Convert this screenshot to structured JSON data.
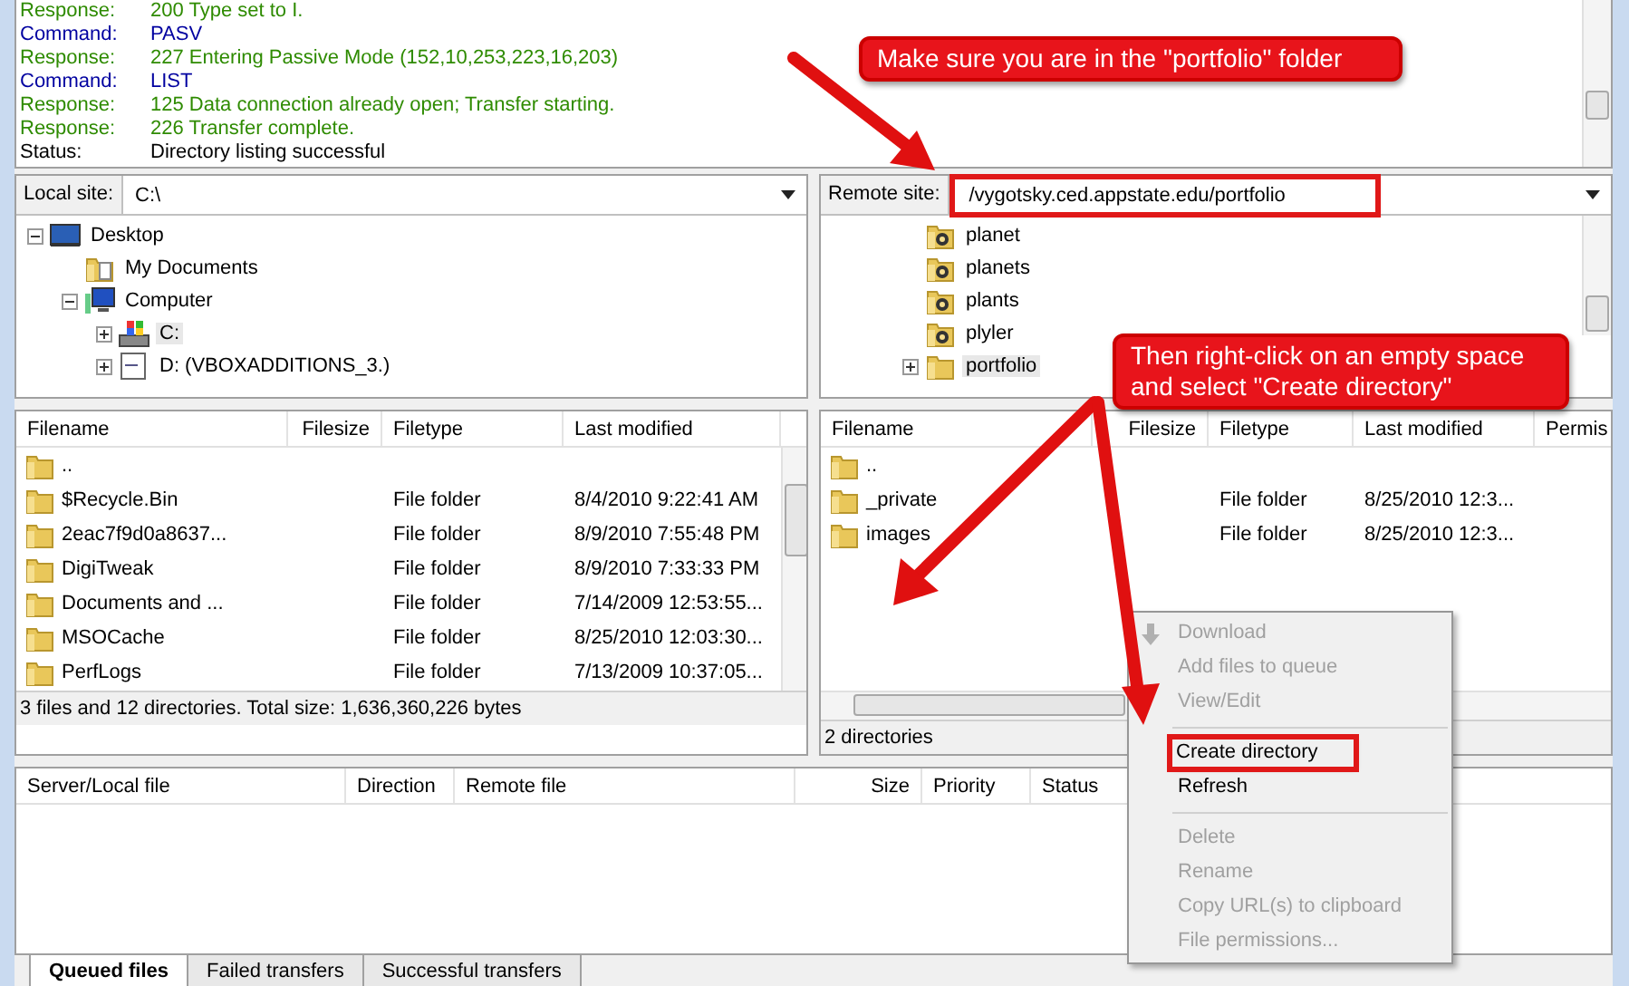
{
  "message_log": [
    {
      "kind": "response",
      "label": "Response:",
      "text": "200 Type set to I."
    },
    {
      "kind": "command",
      "label": "Command:",
      "text": "PASV"
    },
    {
      "kind": "response",
      "label": "Response:",
      "text": "227 Entering Passive Mode (152,10,253,223,16,203)"
    },
    {
      "kind": "command",
      "label": "Command:",
      "text": "LIST"
    },
    {
      "kind": "response",
      "label": "Response:",
      "text": "125 Data connection already open; Transfer starting."
    },
    {
      "kind": "response",
      "label": "Response:",
      "text": "226 Transfer complete."
    },
    {
      "kind": "status",
      "label": "Status:",
      "text": "Directory listing successful"
    }
  ],
  "local_site": {
    "label": "Local site:",
    "path": "C:\\",
    "highlighted": false,
    "tree": [
      {
        "kind": "desktop",
        "name": "Desktop",
        "expanded": true,
        "selected": false,
        "children": [
          {
            "kind": "documents",
            "name": "My Documents",
            "selected": false
          },
          {
            "kind": "computer",
            "name": "Computer",
            "expanded": true,
            "selected": false,
            "children": [
              {
                "kind": "system-drive",
                "name": "C:",
                "expanded": false,
                "selected": true
              },
              {
                "kind": "cd-drive",
                "name": "D: (VBOXADDITIONS_3.)",
                "expanded": false,
                "selected": false
              }
            ]
          }
        ]
      }
    ],
    "files": {
      "columns": [
        "Filename",
        "Filesize",
        "Filetype",
        "Last modified"
      ],
      "rows": [
        {
          "name": "..",
          "type": "",
          "modified": ""
        },
        {
          "name": "$Recycle.Bin",
          "type": "File folder",
          "modified": "8/4/2010 9:22:41 AM"
        },
        {
          "name": "2eac7f9d0a8637...",
          "type": "File folder",
          "modified": "8/9/2010 7:55:48 PM"
        },
        {
          "name": "DigiTweak",
          "type": "File folder",
          "modified": "8/9/2010 7:33:33 PM"
        },
        {
          "name": "Documents and ...",
          "type": "File folder",
          "modified": "7/14/2009 12:53:55..."
        },
        {
          "name": "MSOCache",
          "type": "File folder",
          "modified": "8/25/2010 12:03:30..."
        },
        {
          "name": "PerfLogs",
          "type": "File folder",
          "modified": "7/13/2009 10:37:05..."
        }
      ]
    },
    "status": "3 files and 12 directories. Total size: 1,636,360,226 bytes"
  },
  "remote_site": {
    "label": "Remote site:",
    "path": "/vygotsky.ced.appstate.edu/portfolio",
    "highlighted": true,
    "tree": [
      {
        "kind": "unknown",
        "name": "planet",
        "selected": false
      },
      {
        "kind": "unknown",
        "name": "planets",
        "selected": false
      },
      {
        "kind": "unknown",
        "name": "plants",
        "selected": false
      },
      {
        "kind": "unknown",
        "name": "plyler",
        "selected": false
      },
      {
        "kind": "folder",
        "name": "portfolio",
        "expanded": false,
        "selected": true
      }
    ],
    "files": {
      "columns": [
        "Filename",
        "Filesize",
        "Filetype",
        "Last modified",
        "Permis"
      ],
      "rows": [
        {
          "name": "..",
          "type": "",
          "modified": ""
        },
        {
          "name": "_private",
          "type": "File folder",
          "modified": "8/25/2010 12:3..."
        },
        {
          "name": "images",
          "type": "File folder",
          "modified": "8/25/2010 12:3..."
        }
      ]
    },
    "status": "2 directories"
  },
  "queue": {
    "columns": [
      "Server/Local file",
      "Direction",
      "Remote file",
      "Size",
      "Priority",
      "Status"
    ],
    "tabs": [
      {
        "label": "Queued files",
        "selected": true
      },
      {
        "label": "Failed transfers",
        "selected": false
      },
      {
        "label": "Successful transfers",
        "selected": false
      }
    ]
  },
  "context_menu": [
    {
      "kind": "item",
      "label": "Download",
      "disabled": true,
      "highlighted": false,
      "icon": true
    },
    {
      "kind": "item",
      "label": "Add files to queue",
      "disabled": true,
      "highlighted": false
    },
    {
      "kind": "item",
      "label": "View/Edit",
      "disabled": true,
      "highlighted": false
    },
    {
      "kind": "separator"
    },
    {
      "kind": "item",
      "label": "Create directory",
      "disabled": false,
      "highlighted": true
    },
    {
      "kind": "item",
      "label": "Refresh",
      "disabled": false,
      "highlighted": false
    },
    {
      "kind": "separator"
    },
    {
      "kind": "item",
      "label": "Delete",
      "disabled": true,
      "highlighted": false
    },
    {
      "kind": "item",
      "label": "Rename",
      "disabled": true,
      "highlighted": false
    },
    {
      "kind": "item",
      "label": "Copy URL(s) to clipboard",
      "disabled": true,
      "highlighted": false
    },
    {
      "kind": "item",
      "label": "File permissions...",
      "disabled": true,
      "highlighted": false
    }
  ],
  "annotations": [
    {
      "kind": "callout",
      "text": "Make sure you are in the \"portfolio\" folder"
    },
    {
      "kind": "callout",
      "text": "Then right-click on an empty space and select \"Create directory\""
    }
  ]
}
